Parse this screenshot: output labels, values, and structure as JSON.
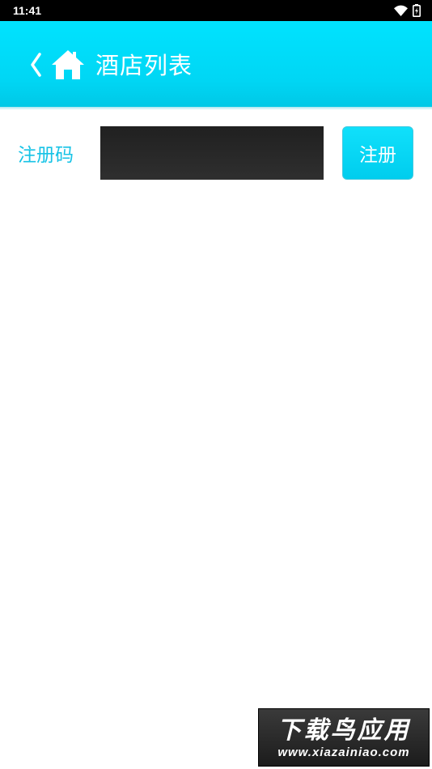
{
  "status_bar": {
    "time": "11:41",
    "icons": [
      "wifi-icon",
      "battery-charging-icon"
    ]
  },
  "header": {
    "title": "酒店列表",
    "icons": [
      "chevron-left-icon",
      "home-icon"
    ],
    "color": "#00d6f4"
  },
  "register": {
    "label": "注册码",
    "input_value": "",
    "button_label": "注册",
    "accent": "#17c3e6"
  },
  "watermark": {
    "title": "下载鸟应用",
    "url": "www.xiazainiao.com"
  }
}
